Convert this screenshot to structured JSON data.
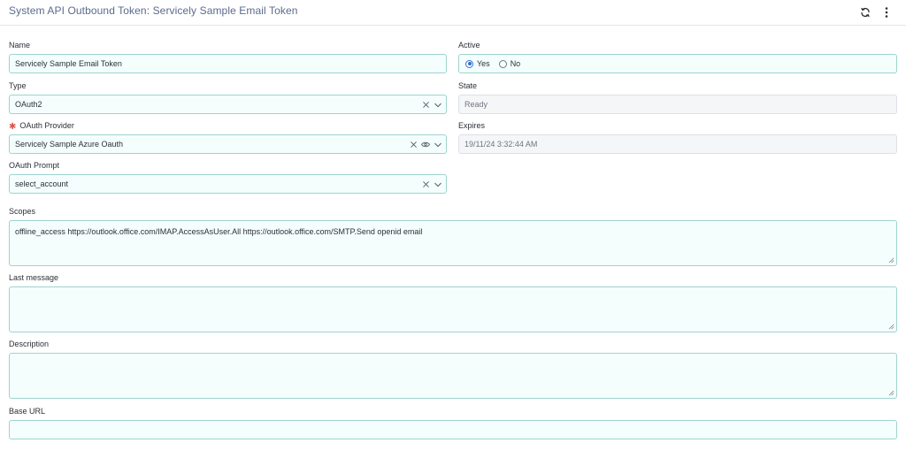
{
  "header": {
    "title": "System API Outbound Token: Servicely Sample Email Token",
    "refresh_icon": "refresh-icon",
    "menu_icon": "more-vertical-icon"
  },
  "form": {
    "name": {
      "label": "Name",
      "value": "Servicely Sample Email Token"
    },
    "active": {
      "label": "Active",
      "options": [
        "Yes",
        "No"
      ],
      "selected": "Yes"
    },
    "type": {
      "label": "Type",
      "value": "OAuth2"
    },
    "state": {
      "label": "State",
      "value": "Ready"
    },
    "oauth_provider": {
      "label": "OAuth Provider",
      "value": "Servicely Sample Azure Oauth",
      "required": true
    },
    "expires": {
      "label": "Expires",
      "value": "19/11/24 3:32:44 AM"
    },
    "oauth_prompt": {
      "label": "OAuth Prompt",
      "value": "select_account"
    },
    "scopes": {
      "label": "Scopes",
      "value": "offline_access https://outlook.office.com/IMAP.AccessAsUser.All https://outlook.office.com/SMTP.Send openid email"
    },
    "last_message": {
      "label": "Last message",
      "value": ""
    },
    "description": {
      "label": "Description",
      "value": ""
    },
    "base_url": {
      "label": "Base URL",
      "value": ""
    }
  },
  "colors": {
    "field_bg": "#f4fffd",
    "field_border": "#9fd3cf",
    "readonly_bg": "#f5f6f8",
    "title": "#5b6b8c",
    "required": "#d9534f",
    "radio_accent": "#2f6fd6"
  }
}
